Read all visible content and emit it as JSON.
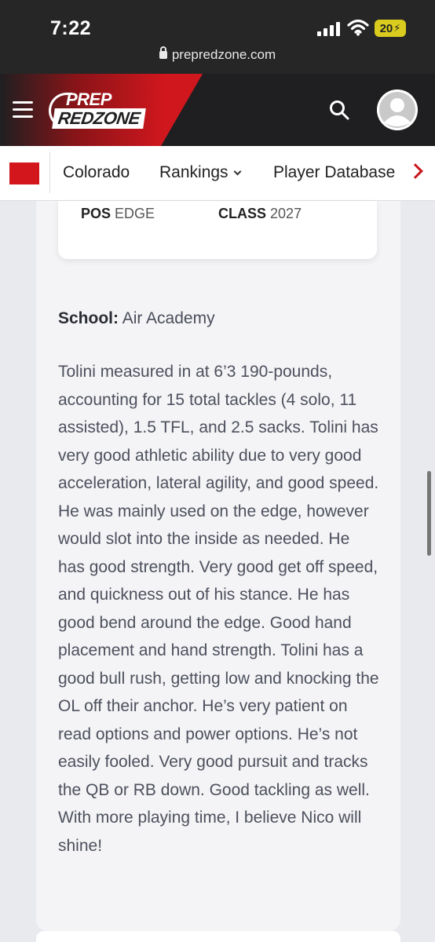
{
  "status_bar": {
    "time": "7:22",
    "battery": "20",
    "url": "prepredzone.com",
    "icons": [
      "signal-icon",
      "wifi-icon",
      "battery-icon",
      "lock-icon"
    ]
  },
  "header": {
    "logo_top": "PREP",
    "logo_bottom": "REDZONE",
    "icons": [
      "menu-icon",
      "search-icon",
      "avatar-icon"
    ],
    "colors": {
      "header_bg": "#1f1f21",
      "brand_red": "#d0171d"
    }
  },
  "nav": {
    "items": [
      "Colorado",
      "Rankings",
      "Player Database"
    ],
    "icons": [
      "flag-icon",
      "chevron-down-icon",
      "chevron-right-icon"
    ]
  },
  "player": {
    "pos_label": "POS",
    "pos_value": "EDGE",
    "class_label": "CLASS",
    "class_value": "2027",
    "school_label": "School:",
    "school_value": "Air Academy",
    "evaluation": "Tolini measured in at 6’3 190-pounds, accounting for 15 total tackles (4 solo, 11 assisted), 1.5 TFL, and 2.5 sacks. Tolini has very good athletic ability due to very good acceleration, lateral agility, and good speed. He was mainly used on the edge, however would slot into the inside as needed. He has good strength. Very good get off speed, and quickness out of his stance. He has good bend around the edge. Good hand placement and hand strength. Tolini has a good bull rush, getting low and knocking the OL off their anchor. He’s very patient on read options and power options. He’s not easily fooled. Very good pursuit and tracks the QB or RB down. Good tackling as well. With more playing time, I believe Nico will shine!"
  }
}
